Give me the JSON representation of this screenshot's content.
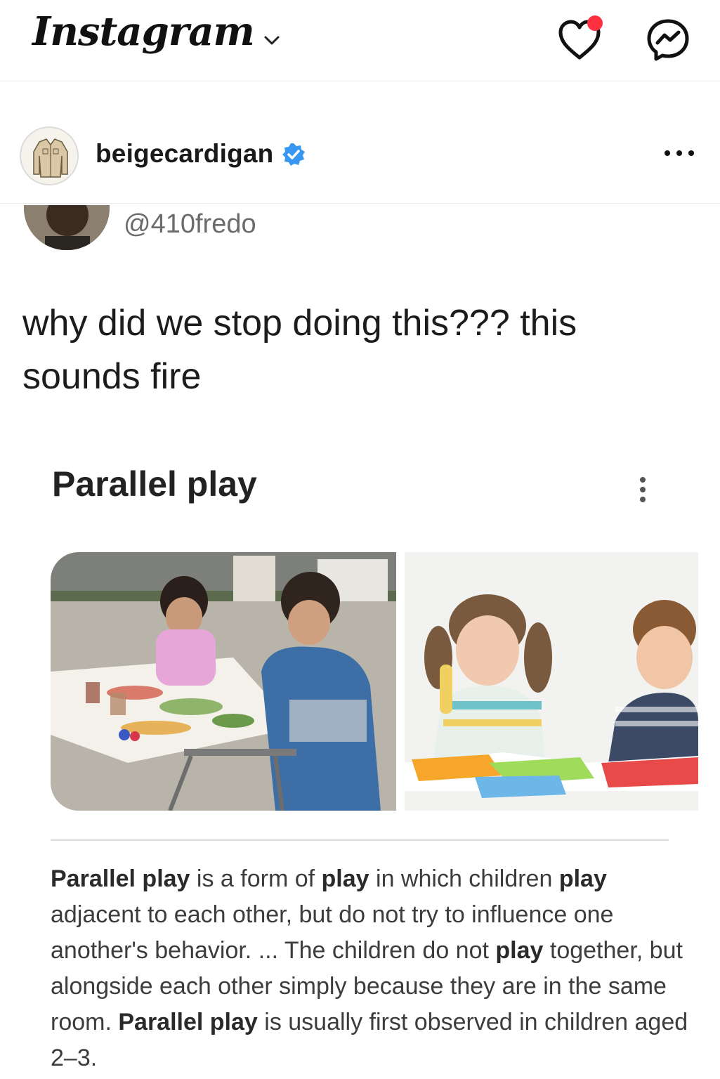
{
  "app": {
    "logo_text": "Instagram"
  },
  "post": {
    "username": "beigecardigan",
    "verified": true
  },
  "tweet": {
    "handle": "@410fredo",
    "text": "why did we stop doing this??? this sounds fire"
  },
  "search_card": {
    "title": "Parallel play",
    "images": [
      {
        "icon": "children-painting-photo"
      },
      {
        "icon": "children-crafting-photo"
      }
    ],
    "snippet": {
      "s1": "Parallel play",
      "s2": " is a form of ",
      "s3": "play",
      "s4": " in which children ",
      "s5": "play",
      "s6": " adjacent to each other, but do not try to influence one another's behavior. ... The children do not ",
      "s7": "play",
      "s8": " together, but alongside each other simply because they are in the same room. ",
      "s9": "Parallel play",
      "s10": " is usually first observed in children aged 2–3."
    }
  },
  "colors": {
    "notification_dot": "#ff3040",
    "verified_badge": "#3897f0"
  }
}
